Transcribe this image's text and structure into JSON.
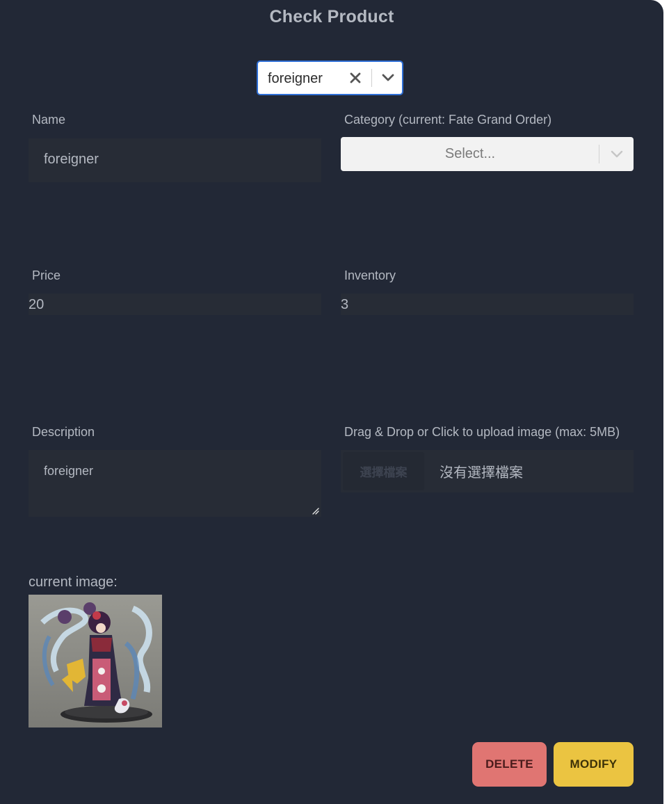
{
  "page": {
    "title": "Check Product"
  },
  "product_selector": {
    "value": "foreigner",
    "clear_icon": "x-icon",
    "dropdown_icon": "chevron-down-icon"
  },
  "form": {
    "name": {
      "label": "Name",
      "value": "foreigner"
    },
    "category": {
      "label": "Category (current: Fate Grand Order)",
      "placeholder": "Select...",
      "dropdown_icon": "chevron-down-icon"
    },
    "price": {
      "label": "Price",
      "value": "20"
    },
    "inventory": {
      "label": "Inventory",
      "value": "3"
    },
    "description": {
      "label": "Description",
      "value": "foreigner"
    },
    "upload": {
      "label": "Drag & Drop or Click to upload image (max: 5MB)",
      "button_label": "選擇檔案",
      "status": "沒有選擇檔案"
    }
  },
  "current_image": {
    "label": "current image:"
  },
  "actions": {
    "delete_label": "DELETE",
    "modify_label": "MODIFY"
  },
  "colors": {
    "background": "#222836",
    "field_background": "#272c36",
    "text": "#b4b9c2",
    "focus_border": "#2f6fd6",
    "delete": "#e07572",
    "modify": "#ebc441"
  }
}
